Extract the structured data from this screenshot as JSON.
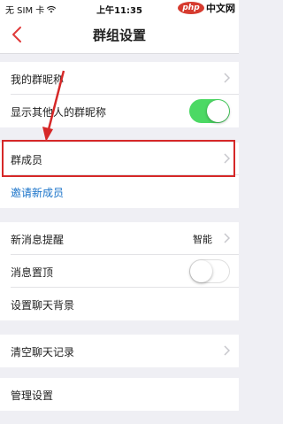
{
  "status_bar": {
    "carrier": "无 SIM 卡",
    "time": "上午11:35",
    "watermark_logo": "php",
    "watermark_text": "中文网"
  },
  "nav": {
    "title": "群组设置",
    "back_icon": "chevron-left-icon"
  },
  "rows": {
    "my_nickname": "我的群昵称",
    "show_nicknames": "显示其他人的群昵称",
    "show_nicknames_toggle": true,
    "members": "群成员",
    "invite": "邀请新成员",
    "new_message_alert": "新消息提醒",
    "new_message_alert_value": "智能",
    "pin_chat": "消息置顶",
    "pin_chat_toggle": false,
    "chat_background": "设置聊天背景",
    "clear_history": "清空聊天记录",
    "manage": "管理设置"
  },
  "colors": {
    "accent_red": "#d62828",
    "toggle_on": "#4cd964",
    "link_blue": "#1a73c9",
    "page_bg": "#efeff4"
  }
}
